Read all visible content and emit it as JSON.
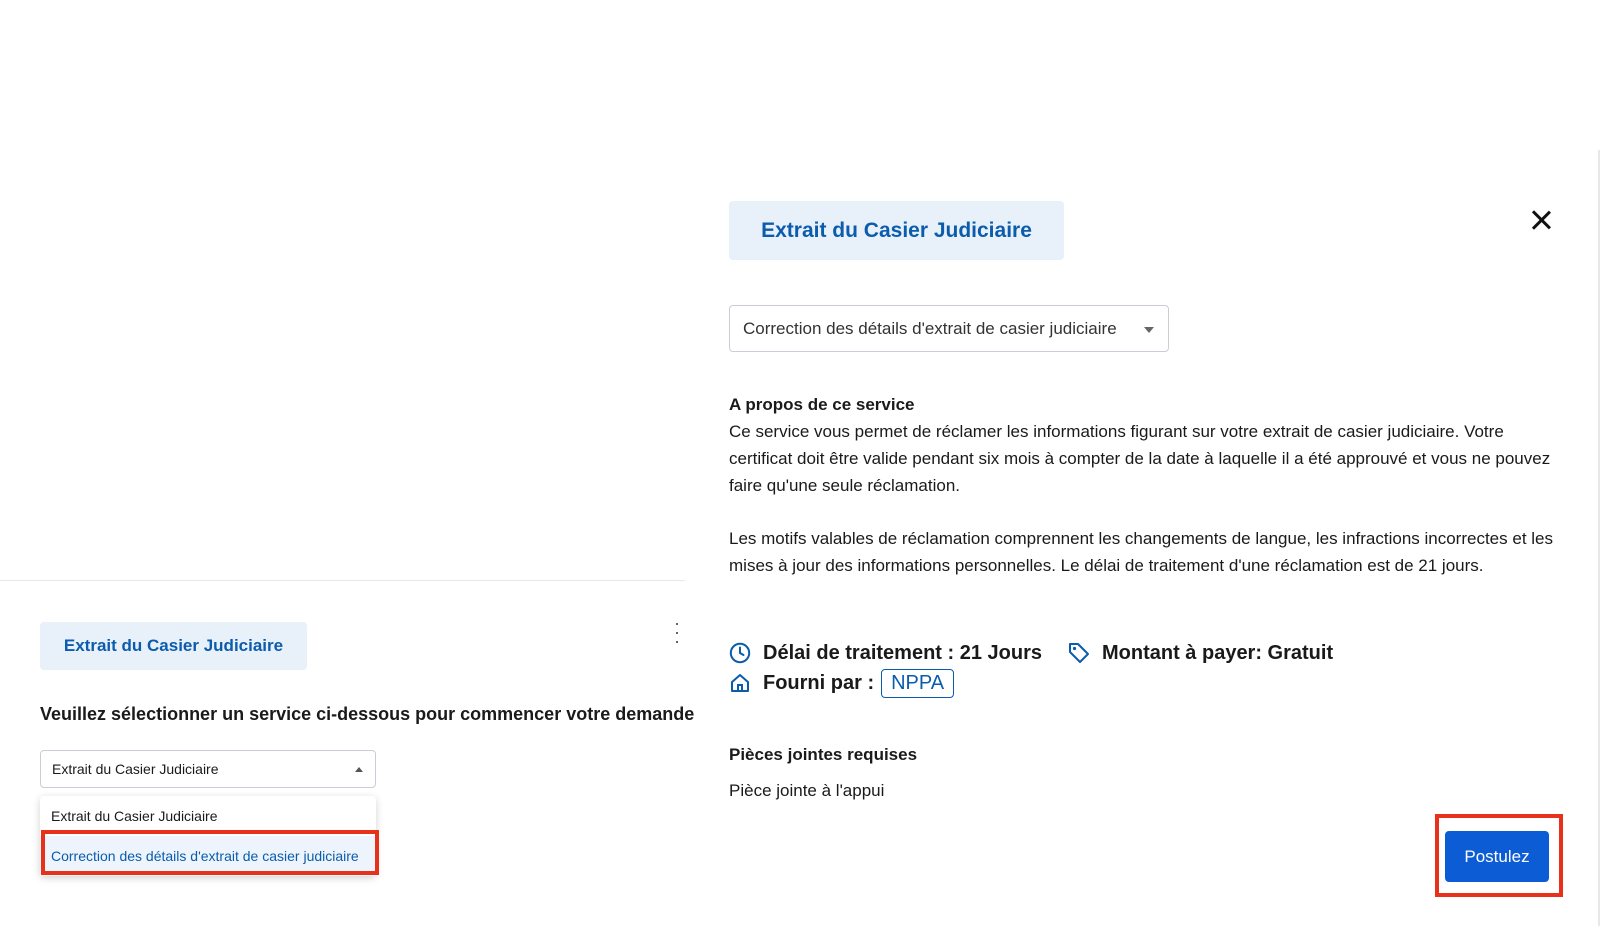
{
  "left": {
    "chip_label": "Extrait du Casier Judiciaire",
    "instruction": "Veuillez sélectionner un service ci-dessous pour commencer votre demande",
    "select_value": "Extrait du Casier Judiciaire",
    "dropdown_options": [
      "Extrait du Casier Judiciaire",
      "Correction des détails d'extrait de casier judiciaire"
    ]
  },
  "right": {
    "chip_label": "Extrait du Casier Judiciaire",
    "select_value": "Correction des détails d'extrait de casier judiciaire",
    "about_title": "A propos de ce service",
    "about_paragraphs": [
      "Ce service vous permet de réclamer les informations figurant sur votre extrait de casier judiciaire. Votre certificat doit être valide pendant six mois à compter de la date à laquelle il a été approuvé et vous ne pouvez faire qu'une seule réclamation.",
      "Les motifs valables de réclamation comprennent les changements de langue, les infractions incorrectes et les mises à jour des informations personnelles. Le délai de traitement d'une réclamation est de 21 jours."
    ],
    "processing_time": "Délai de traitement : 21 Jours",
    "amount": "Montant à payer: Gratuit",
    "provided_by_label": "Fourni par :",
    "provider": "NPPA",
    "attachments_title": "Pièces jointes requises",
    "attachment_item": "Pièce jointe à l'appui",
    "apply_label": "Postulez"
  },
  "colors": {
    "accent": "#0b5cad",
    "button": "#0b5cd5",
    "chip_bg": "#e8f0fa",
    "highlight": "#e8311a"
  },
  "icons": [
    "clock-icon",
    "tag-icon",
    "home-icon",
    "close-icon",
    "kebab-menu-icon",
    "caret-up-icon",
    "caret-down-icon"
  ]
}
